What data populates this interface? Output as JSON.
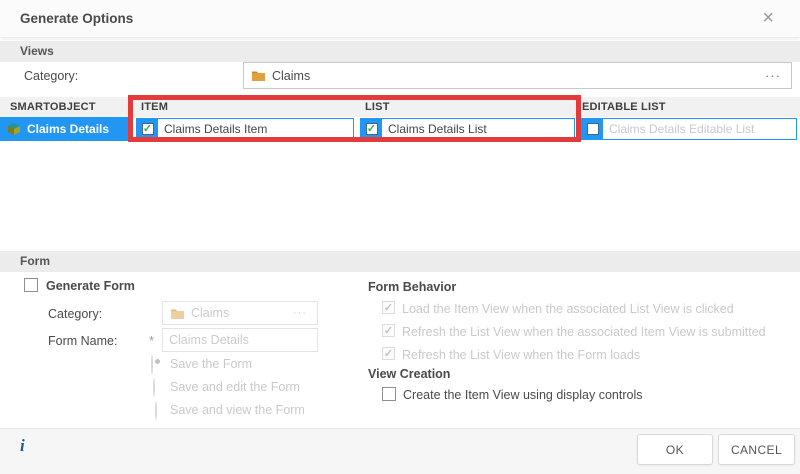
{
  "dialog": {
    "title": "Generate Options"
  },
  "icons": {
    "close": "×",
    "ellipsis": "···",
    "check": "✓",
    "asterisk": "*",
    "info": "i"
  },
  "views": {
    "section_label": "Views",
    "category": {
      "label": "Category:",
      "value": "Claims"
    },
    "grid": {
      "headers": [
        "SMARTOBJECT",
        "ITEM",
        "LIST",
        "EDITABLE LIST"
      ],
      "row": {
        "name": "Claims Details",
        "item": {
          "checked": true,
          "value": "Claims Details Item"
        },
        "list": {
          "checked": true,
          "value": "Claims Details List"
        },
        "editable_list": {
          "checked": false,
          "placeholder": "Claims Details Editable List"
        }
      }
    }
  },
  "form": {
    "section_label": "Form",
    "generate_form_label": "Generate Form",
    "generate_form_checked": false,
    "category": {
      "label": "Category:",
      "value": "Claims",
      "disabled": true
    },
    "form_name": {
      "label": "Form Name:",
      "value": "Claims Details",
      "disabled": true
    },
    "save_options": [
      {
        "label": "Save the Form",
        "selected": true
      },
      {
        "label": "Save and edit the Form",
        "selected": false
      },
      {
        "label": "Save and view the Form",
        "selected": false
      }
    ],
    "behavior": {
      "heading": "Form Behavior",
      "options": [
        {
          "label": "Load the Item View when the associated List View is clicked",
          "checked": true,
          "disabled": true
        },
        {
          "label": "Refresh the List View when the associated Item View is submitted",
          "checked": true,
          "disabled": true
        },
        {
          "label": "Refresh the List View when the Form loads",
          "checked": true,
          "disabled": true
        }
      ]
    },
    "view_creation": {
      "heading": "View Creation",
      "options": [
        {
          "label": "Create the Item View using display controls",
          "checked": false,
          "disabled": false
        }
      ]
    }
  },
  "footer": {
    "ok_label": "OK",
    "cancel_label": "CANCEL"
  },
  "colors": {
    "selection_blue": "#2196f3",
    "highlight_red": "#e23b3b",
    "check_green": "#3fae49"
  }
}
